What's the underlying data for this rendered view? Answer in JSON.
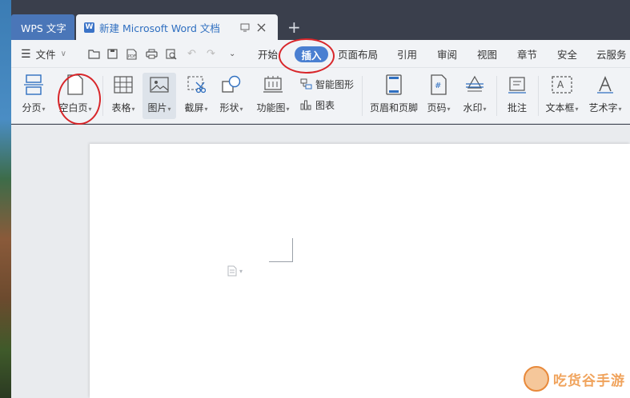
{
  "tabs": {
    "app_label": "WPS 文字",
    "doc_label": "新建 Microsoft Word 文档",
    "doc_icon": "W",
    "new_tab": "+"
  },
  "menubar": {
    "file_label": "文件",
    "tabs": [
      "开始",
      "插入",
      "页面布局",
      "引用",
      "审阅",
      "视图",
      "章节",
      "安全",
      "云服务"
    ],
    "active_tab": "插入"
  },
  "ribbon": {
    "page_break": "分页",
    "blank_page": "空白页",
    "table": "表格",
    "picture": "图片",
    "screenshot": "截屏",
    "shape": "形状",
    "function_chart": "功能图",
    "smart_art": "智能图形",
    "chart": "图表",
    "header_footer": "页眉和页脚",
    "page_number": "页码",
    "watermark": "水印",
    "comment": "批注",
    "text_box": "文本框",
    "word_art": "艺术字"
  },
  "watermark_brand": "吃货谷手游",
  "colors": {
    "accent": "#4a7fd1",
    "annotation": "#d8262a",
    "titlebar": "#3a3f4c"
  }
}
